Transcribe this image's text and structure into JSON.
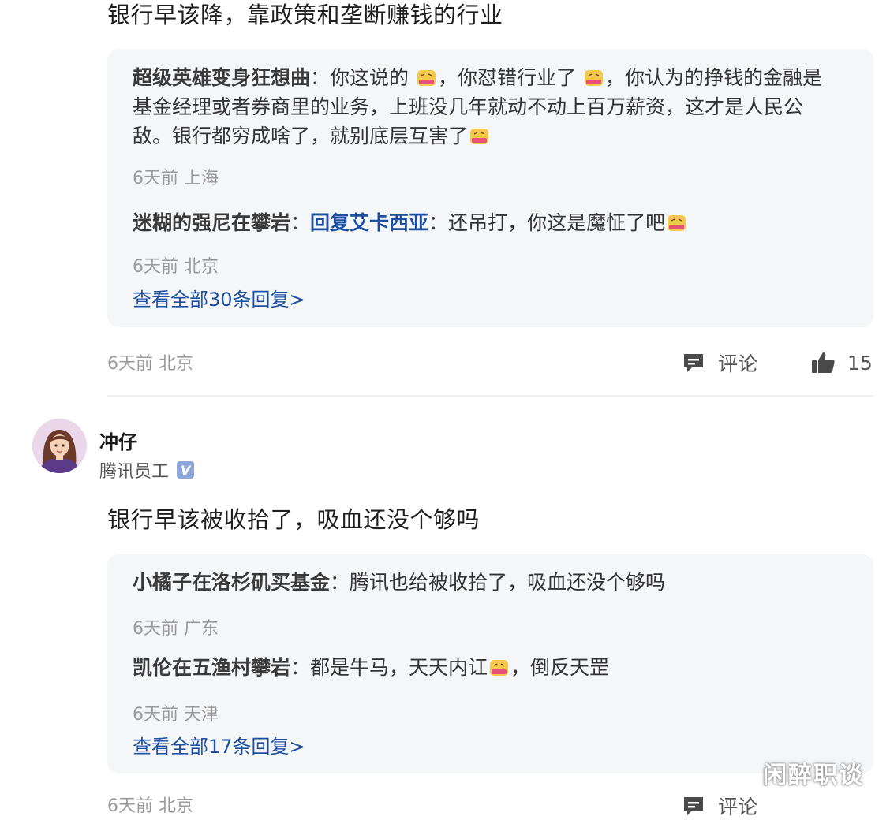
{
  "comments": [
    {
      "text": "银行早该降，靠政策和垄断赚钱的行业",
      "replies": [
        {
          "author": "超级英雄变身狂想曲",
          "sep": "：",
          "segments": [
            "你这说的",
            "，你怼错行业了",
            "，你认为的挣钱的金融是",
            "基金经理或者券商里的业务，上班没几年就动不动上百万薪资，这才是人民公",
            "敌。银行都穷成啥了，就别底层互害了"
          ],
          "meta": "6天前 上海"
        },
        {
          "author": "迷糊的强尼在攀岩",
          "sep": "：",
          "reply_to": "回复艾卡西亚",
          "reply_to_sep": "：",
          "text": "还吊打，你这是魔怔了吧",
          "meta": "6天前 北京"
        }
      ],
      "view_all": "查看全部30条回复>",
      "meta": "6天前 北京",
      "comment_label": "评论",
      "likes": "15"
    },
    {
      "user": {
        "name": "冲仔",
        "title": "腾讯员工",
        "verified_badge": "V"
      },
      "text": "银行早该被收拾了，吸血还没个够吗",
      "replies": [
        {
          "author": "小橘子在洛杉矶买基金",
          "sep": "：",
          "text": "腾讯也给被收拾了，吸血还没个够吗",
          "meta": "6天前 广东"
        },
        {
          "author": "凯伦在五渔村攀岩",
          "sep": "：",
          "segments": [
            "都是牛马，天天内讧",
            "，倒反天罡"
          ],
          "meta": "6天前 天津"
        }
      ],
      "view_all": "查看全部17条回复>",
      "meta": "6天前 北京",
      "comment_label": "评论"
    }
  ],
  "watermark": "闲醉职谈",
  "colors": {
    "link": "#1e50a2",
    "reply_bg": "#f5f6f8",
    "meta": "#9a9a9a",
    "emoji": "#f2c94c"
  },
  "icons": {
    "emoji": "grimace-emoji-icon",
    "comment": "comment-icon",
    "like": "thumbs-up-icon",
    "verified": "verified-badge-icon"
  }
}
